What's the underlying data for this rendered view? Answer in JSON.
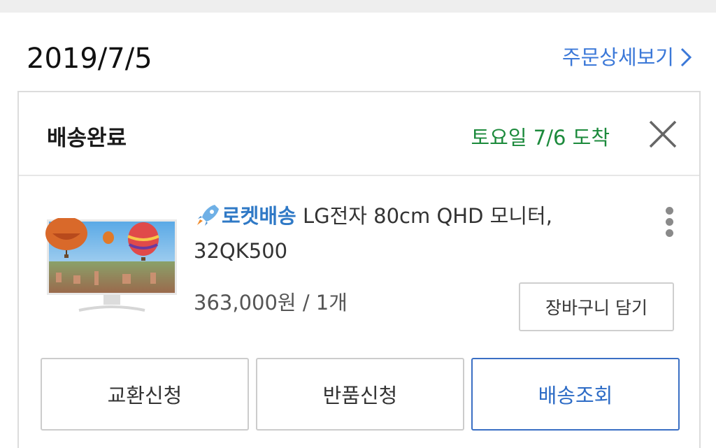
{
  "order": {
    "date": "2019/7/5",
    "detail_link": "주문상세보기"
  },
  "delivery": {
    "status": "배송완료",
    "arrival": "토요일 7/6 도착"
  },
  "product": {
    "badge": "로켓배송",
    "name": "LG전자 80cm QHD 모니터, 32QK500",
    "price": "363,000원 / 1개"
  },
  "buttons": {
    "cart": "장바구니 담기",
    "exchange": "교환신청",
    "return": "반품신청",
    "track": "배송조회"
  },
  "colors": {
    "link_blue": "#3b78d8",
    "arrival_green": "#1c8a3c",
    "track_border": "#3a6fc4"
  },
  "icons": [
    "chevron-right-icon",
    "close-icon",
    "rocket-icon",
    "more-vertical-icon"
  ]
}
